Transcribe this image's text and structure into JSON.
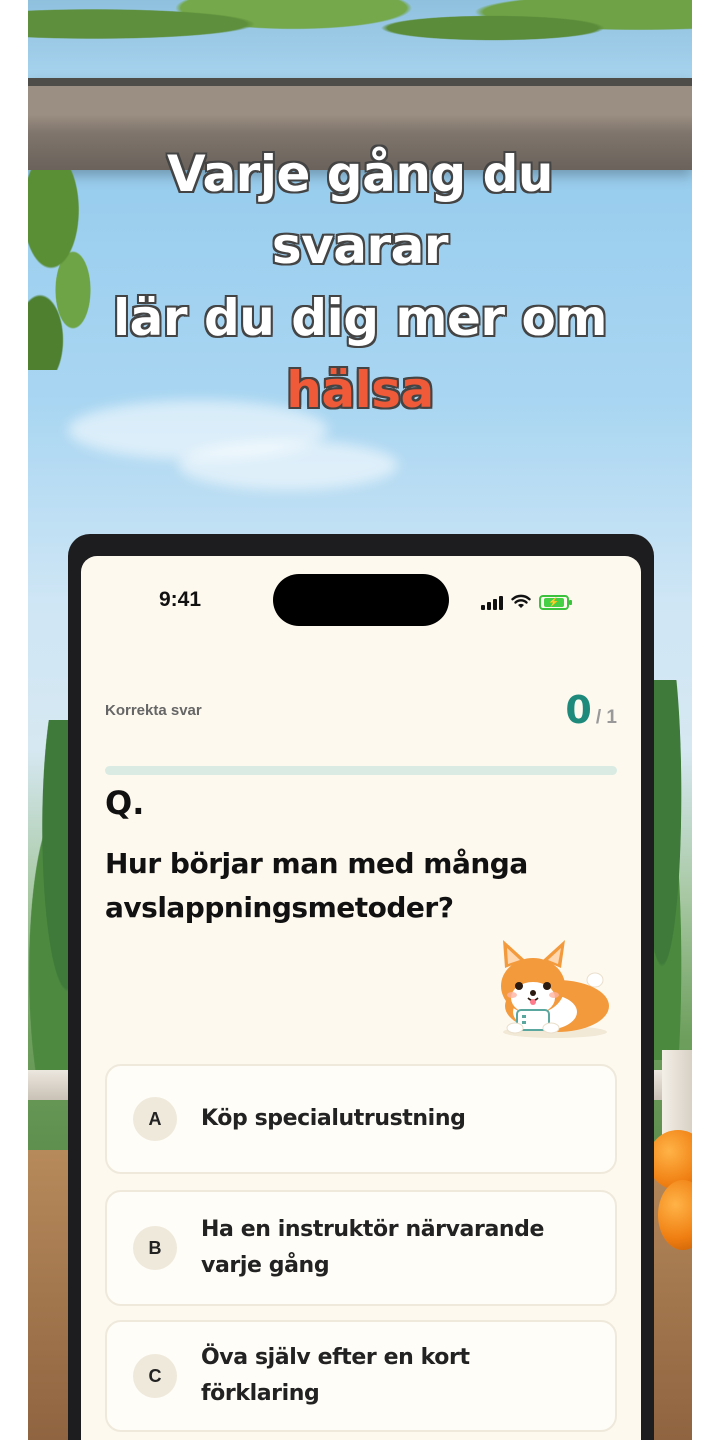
{
  "headline": {
    "line1": "Varje gång du",
    "line2": "svarar",
    "line3": "lär du dig mer om",
    "accent_word": "hälsa"
  },
  "status_bar": {
    "time": "9:41",
    "icons": [
      "signal-icon",
      "wifi-icon",
      "battery-icon"
    ]
  },
  "score": {
    "label": "Korrekta svar",
    "value": "0",
    "total": "/ 1"
  },
  "progress": {
    "fraction": 0.0
  },
  "question": {
    "marker": "Q.",
    "text": "Hur börjar man med många avslappningsmetoder?"
  },
  "options": [
    {
      "letter": "A",
      "text": "Köp specialutrustning"
    },
    {
      "letter": "B",
      "text": "Ha en instruktör närvarande varje gång"
    },
    {
      "letter": "C",
      "text": "Öva själv efter en kort förklaring"
    }
  ],
  "colors": {
    "accent_teal": "#1e8a7c",
    "headline_accent": "#ef5a38",
    "screen_bg": "#fdf9ef"
  }
}
